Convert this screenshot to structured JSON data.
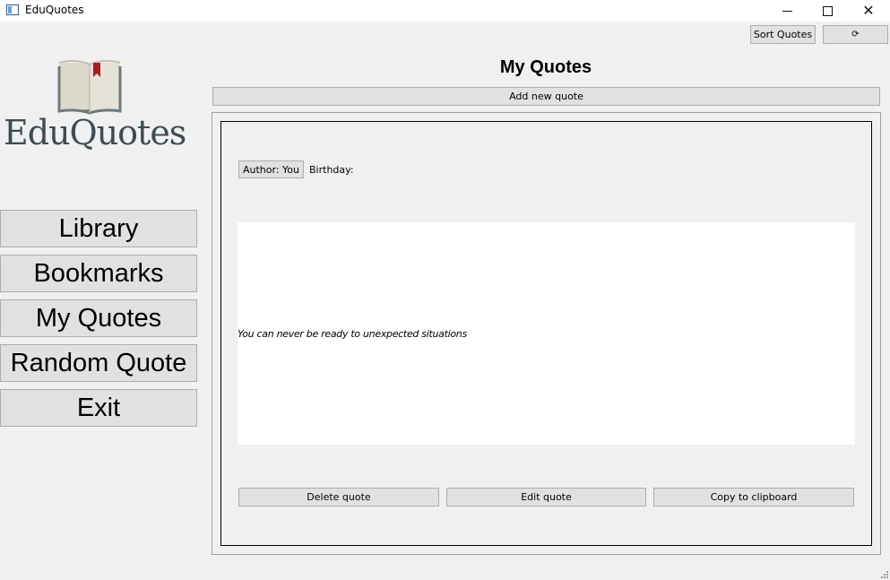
{
  "window": {
    "title": "EduQuotes",
    "controls": {
      "minimize": "minimize-icon",
      "maximize": "maximize-icon",
      "close": "✕"
    }
  },
  "toolbar": {
    "sort_label": "Sort Quotes",
    "refresh_label": "⟳"
  },
  "logo": {
    "text": "EduQuotes",
    "colors": {
      "book": "#6d7a7e",
      "pages": "#ddd8cc",
      "bookmark": "#a31f24",
      "text": "#3d4c52"
    }
  },
  "nav": {
    "items": [
      {
        "label": "Library"
      },
      {
        "label": "Bookmarks"
      },
      {
        "label": "My Quotes"
      },
      {
        "label": "Random Quote"
      },
      {
        "label": "Exit"
      }
    ]
  },
  "main": {
    "title": "My Quotes",
    "add_label": "Add new quote",
    "quote": {
      "author_label": "Author: You",
      "birthday_label": "Birthday:",
      "text": "You can never be ready to unexpected situations"
    },
    "actions": {
      "delete_label": "Delete quote",
      "edit_label": "Edit quote",
      "copy_label": "Copy to clipboard"
    }
  }
}
